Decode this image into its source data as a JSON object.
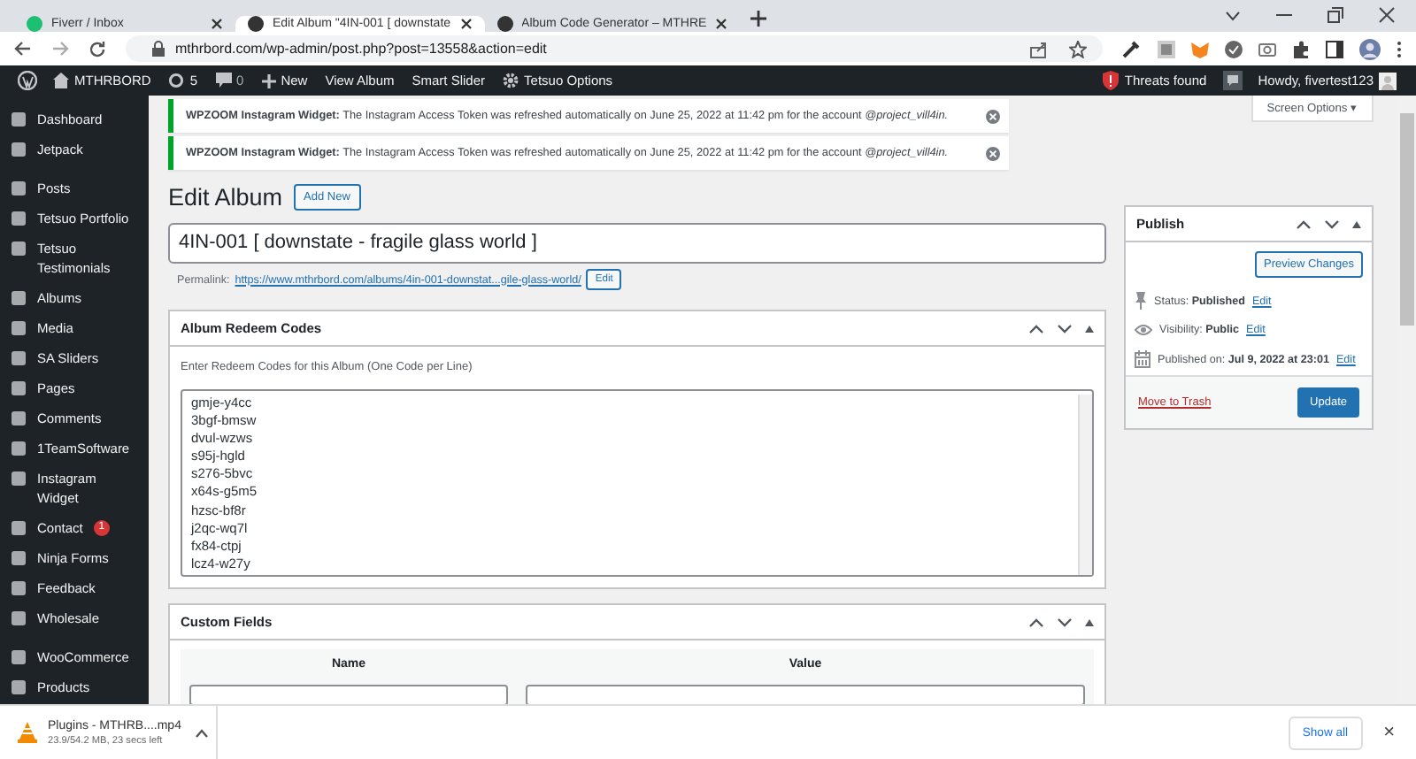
{
  "browser": {
    "tabs": [
      {
        "label": "Fiverr / Inbox",
        "selected": false
      },
      {
        "label": "Edit Album \"4IN-001 [ downstate",
        "selected": true
      },
      {
        "label": "Album Code Generator – MTHRE",
        "selected": false
      }
    ],
    "address": "mthrbord.com/wp-admin/post.php?post=13558&action=edit"
  },
  "admin_bar": {
    "site": "MTHRBORD",
    "updates": "5",
    "comments": "0",
    "items": [
      "New",
      "View Album",
      "Smart Slider",
      "Tetsuo Options"
    ],
    "threats": "Threats found",
    "greeting": "Howdy, fivertest123"
  },
  "sidebar": {
    "items": [
      {
        "label": "Dashboard"
      },
      {
        "label": "Jetpack"
      },
      {
        "label": "Posts"
      },
      {
        "label": "Tetsuo Portfolio"
      },
      {
        "label": "Tetsuo Testimonials"
      },
      {
        "label": "Albums"
      },
      {
        "label": "Media"
      },
      {
        "label": "SA Sliders"
      },
      {
        "label": "Pages"
      },
      {
        "label": "Comments"
      },
      {
        "label": "1TeamSoftware"
      },
      {
        "label": "Instagram Widget"
      },
      {
        "label": "Contact",
        "badge": "1"
      },
      {
        "label": "Ninja Forms"
      },
      {
        "label": "Feedback"
      },
      {
        "label": "Wholesale"
      },
      {
        "label": "WooCommerce"
      },
      {
        "label": "Products"
      }
    ]
  },
  "notices": [
    "**WPZOOM Instagram Widget:** The Instagram Access Token was refreshed automatically on June 25, 2022 at 11:42 pm for the account *@project_vill4in.*",
    "**WPZOOM Instagram Widget:** The Instagram Access Token was refreshed automatically on June 25, 2022 at 11:42 pm for the account *@project_vill4in.*"
  ],
  "screen_options": "Screen Options ▾",
  "heading": "Edit Album",
  "add_new": "Add New",
  "title": "4IN-001 [ downstate - fragile glass world ]",
  "permalink": {
    "label": "Permalink:",
    "url": "https://www.mthrbord.com/albums/4in-001-downstat...gile-glass-world/",
    "edit": "Edit"
  },
  "redeem_box": {
    "title": "Album Redeem Codes",
    "hint": "Enter Redeem Codes for this Album (One Code per Line)",
    "codes": [
      "gmje-y4cc",
      "3bgf-bmsw",
      "dvul-wzws",
      "s95j-hgld",
      "s276-5bvc",
      "x64s-g5m5",
      "hzsc-bf8r",
      "j2qc-wq7l",
      "fx84-ctpj",
      "lcz4-w27y"
    ]
  },
  "custom_fields": {
    "title": "Custom Fields",
    "columns": [
      "Name",
      "Value"
    ]
  },
  "publish": {
    "title": "Publish",
    "preview": "Preview Changes",
    "rows": [
      {
        "kind": "pin",
        "label": "Status:",
        "value": "Published",
        "edit": "Edit"
      },
      {
        "kind": "eye",
        "label": "Visibility:",
        "value": "Public",
        "edit": "Edit"
      },
      {
        "kind": "calendar",
        "label": "Published on:",
        "value": "Jul 9, 2022 at 23:01",
        "edit": "Edit"
      }
    ],
    "trash": "Move to Trash",
    "update": "Update"
  },
  "download": {
    "name": "Plugins - MTHRB....mp4",
    "progress": "23.9/54.2 MB, 23 secs left",
    "show_all": "Show all",
    "close": "×"
  }
}
